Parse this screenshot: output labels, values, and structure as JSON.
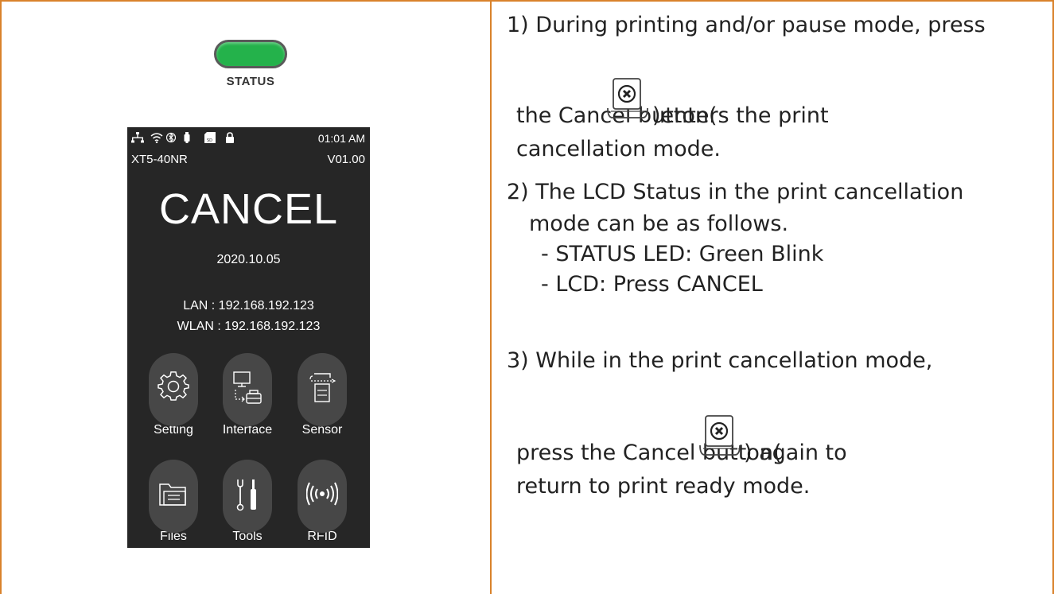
{
  "led": {
    "label": "STATUS",
    "color": "#24b24b"
  },
  "lcd": {
    "time": "01:01 AM",
    "model": "XT5-40NR",
    "version": "V01.00",
    "mode": "CANCEL",
    "date": "2020.10.05",
    "lan": "LAN : 192.168.192.123",
    "wlan": "WLAN : 192.168.192.123",
    "status_icons": [
      "network-icon",
      "wifi-icon",
      "bluetooth-icon",
      "usb-icon",
      "sd-card-icon",
      "lock-icon"
    ],
    "menu": [
      {
        "label": "Setting",
        "icon": "gear-icon"
      },
      {
        "label": "Interface",
        "icon": "interface-icon"
      },
      {
        "label": "Sensor",
        "icon": "sensor-icon"
      },
      {
        "label": "Files",
        "icon": "folder-icon"
      },
      {
        "label": "Tools",
        "icon": "tools-icon"
      },
      {
        "label": "RFID",
        "icon": "rfid-icon"
      }
    ]
  },
  "instructions": {
    "step1": {
      "line1": "1) During printing and/or pause mode, press",
      "line2a": "the Cancel button(",
      "line2b": ")enters the print",
      "line3": "cancellation mode."
    },
    "step2": {
      "line1": "2) The LCD Status in the print cancellation",
      "line2": "mode can be as follows.",
      "bullet1": "- STATUS LED: Green Blink",
      "bullet2": "- LCD: Press CANCEL"
    },
    "step3": {
      "line1": "3) While in the print cancellation mode,",
      "line2a": "press the Cancel button(",
      "line2b": ") again to",
      "line3": "return to print ready mode."
    }
  },
  "colors": {
    "border": "#d9822b",
    "lcd_bg": "#262626",
    "tile_bg": "#474747"
  }
}
